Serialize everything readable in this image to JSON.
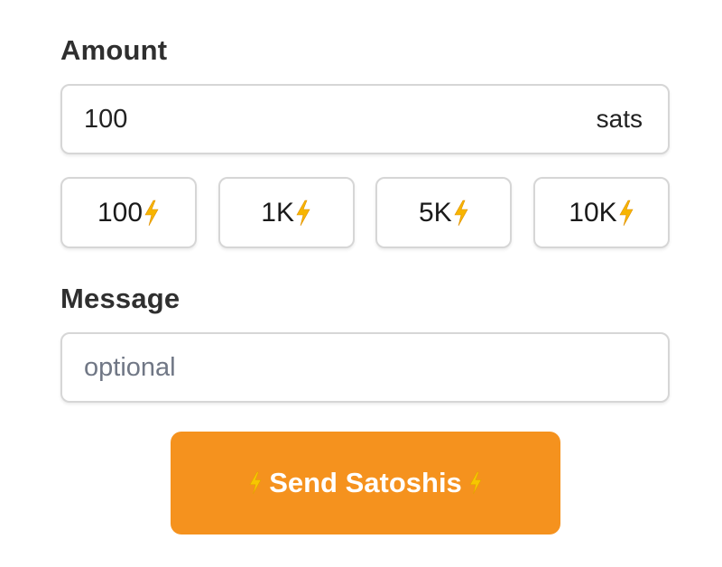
{
  "amount": {
    "label": "Amount",
    "value": "100",
    "unit": "sats"
  },
  "presets": [
    {
      "label": "100"
    },
    {
      "label": "1K"
    },
    {
      "label": "5K"
    },
    {
      "label": "10K"
    }
  ],
  "message": {
    "label": "Message",
    "value": "",
    "placeholder": "optional"
  },
  "send_button": {
    "label": "Send Satoshis"
  },
  "icons": {
    "preset_icon": "lightning-bolt-icon",
    "send_icon": "lightning-bolt-icon"
  },
  "colors": {
    "accent": "#f5921e",
    "bolt": "#f7b500",
    "border": "#d6d6d6"
  }
}
